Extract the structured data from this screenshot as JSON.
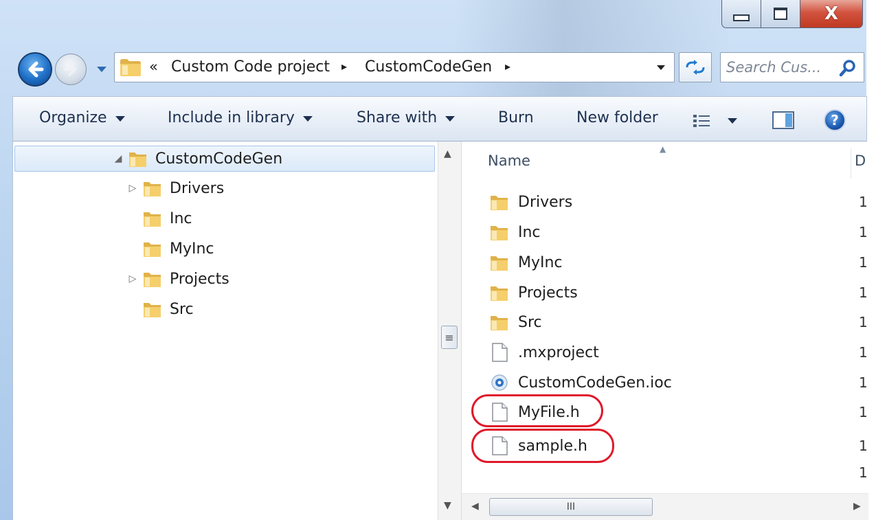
{
  "window": {
    "close_glyph": "X"
  },
  "address_bar": {
    "overflow_chevrons": "«",
    "breadcrumbs": [
      "Custom Code project",
      "CustomCodeGen"
    ],
    "separator": "▸"
  },
  "search": {
    "placeholder": "Search Cus..."
  },
  "command_bar": {
    "organize": "Organize",
    "include_in_library": "Include in library",
    "share_with": "Share with",
    "burn": "Burn",
    "new_folder": "New folder",
    "help": "?"
  },
  "nav_tree": {
    "root": {
      "label": "CustomCodeGen",
      "expanded": true,
      "selected": true
    },
    "children": [
      {
        "label": "Drivers",
        "has_children": true
      },
      {
        "label": "Inc",
        "has_children": false
      },
      {
        "label": "MyInc",
        "has_children": false
      },
      {
        "label": "Projects",
        "has_children": true
      },
      {
        "label": "Src",
        "has_children": false
      }
    ]
  },
  "file_list": {
    "columns": {
      "name": "Name",
      "date_fragment": "D"
    },
    "items": [
      {
        "name": "Drivers",
        "type": "folder",
        "date_fragment": "1"
      },
      {
        "name": "Inc",
        "type": "folder",
        "date_fragment": "1"
      },
      {
        "name": "MyInc",
        "type": "folder",
        "date_fragment": "1"
      },
      {
        "name": "Projects",
        "type": "folder",
        "date_fragment": "1"
      },
      {
        "name": "Src",
        "type": "folder",
        "date_fragment": "1"
      },
      {
        "name": ".mxproject",
        "type": "file",
        "date_fragment": "1"
      },
      {
        "name": "CustomCodeGen.ioc",
        "type": "ioc",
        "date_fragment": "1"
      },
      {
        "name": "MyFile.h",
        "type": "file",
        "date_fragment": "1",
        "highlighted": true
      },
      {
        "name": "sample.h",
        "type": "file",
        "date_fragment": "1",
        "highlighted": true
      }
    ],
    "extra_date_fragment": "1"
  },
  "scrollbars": {
    "nav_thumb_grip": "≡",
    "h_thumb_grip": "III",
    "up": "▲",
    "down": "▼",
    "left": "◀",
    "right": "▶"
  },
  "colors": {
    "highlight_ring": "#e0192b",
    "title_glass": "#b9d3ef",
    "selection": "#dbe9f8"
  },
  "icons": {
    "folder": "folder-icon",
    "file": "file-icon",
    "ioc": "stm32cubemx-file-icon",
    "search": "search-icon",
    "back": "back-arrow-icon",
    "forward": "forward-arrow-icon",
    "refresh": "refresh-icon",
    "help": "help-icon"
  }
}
